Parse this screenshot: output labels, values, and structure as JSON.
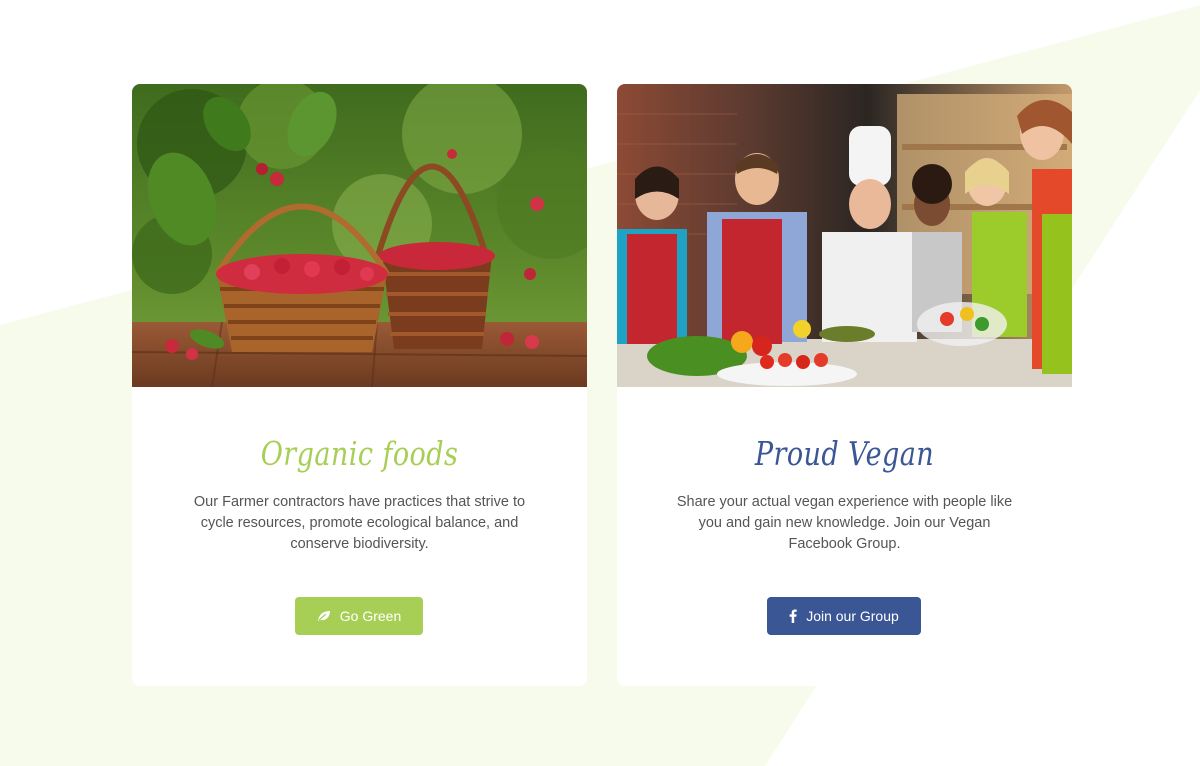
{
  "cards": [
    {
      "image_alt": "Baskets of raspberries on a wooden table",
      "title": "Organic foods",
      "text": "Our Farmer contractors have practices that strive to cycle resources, promote ecological balance, and conserve biodiversity.",
      "button_label": "Go Green",
      "button_icon": "leaf-icon",
      "accent": "#a7cf55"
    },
    {
      "image_alt": "Group cooking class with a chef in a kitchen",
      "title": "Proud Vegan",
      "text": "Share your actual vegan experience with people like you and gain new knowledge. Join our Vegan Facebook Group.",
      "button_label": "Join our Group",
      "button_icon": "facebook-icon",
      "accent": "#3a5694"
    }
  ],
  "colors": {
    "background_shape": "#f7fbec",
    "green": "#a7cf55",
    "blue": "#3a5694",
    "text": "#555555"
  }
}
